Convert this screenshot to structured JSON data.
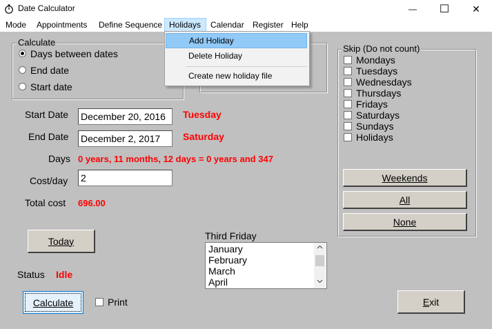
{
  "window": {
    "title": "Date Calculator",
    "icon": "stopwatch-icon",
    "min_glyph": "—",
    "max_glyph": "☐",
    "close_glyph": "✕"
  },
  "menubar": {
    "items": [
      "Mode",
      "Appointments",
      "Define Sequence",
      "Holidays",
      "Calendar",
      "Register",
      "Help"
    ],
    "open_menu": "Holidays"
  },
  "holidays_menu": {
    "items": [
      "Add Holiday",
      "Delete Holiday",
      "Create new holiday file"
    ],
    "highlighted": "Add Holiday"
  },
  "calculate": {
    "legend": "Calculate",
    "options": [
      "Days between dates",
      "End date",
      "Start date"
    ],
    "selected": "Days between dates"
  },
  "fields": {
    "start_date_label": "Start Date",
    "start_date_value": "December 20, 2016",
    "start_day": "Tuesday",
    "end_date_label": "End Date",
    "end_date_value": "December 2, 2017",
    "end_day": "Saturday",
    "days_label": "Days",
    "days_value": "0 years, 11 months, 12 days = 0 years and 347",
    "cost_label": "Cost/day",
    "cost_value": "2",
    "total_label": "Total cost",
    "total_value": "696.00"
  },
  "skip": {
    "legend": "Skip (Do not count)",
    "options": [
      "Mondays",
      "Tuesdays",
      "Wednesdays",
      "Thursdays",
      "Fridays",
      "Saturdays",
      "Sundays",
      "Holidays"
    ],
    "buttons": {
      "weekends": "Weekends",
      "all": "All",
      "none": "None"
    }
  },
  "third_friday": {
    "label": "Third Friday",
    "items": [
      "January",
      "February",
      "March",
      "April"
    ]
  },
  "buttons": {
    "today": "Today",
    "calculate": "Calculate",
    "exit": "Exit",
    "print_label": "Print"
  },
  "status": {
    "label": "Status",
    "value": "Idle"
  },
  "colors": {
    "accent_red": "#ff0000",
    "menu_highlight": "#91c9f7"
  }
}
